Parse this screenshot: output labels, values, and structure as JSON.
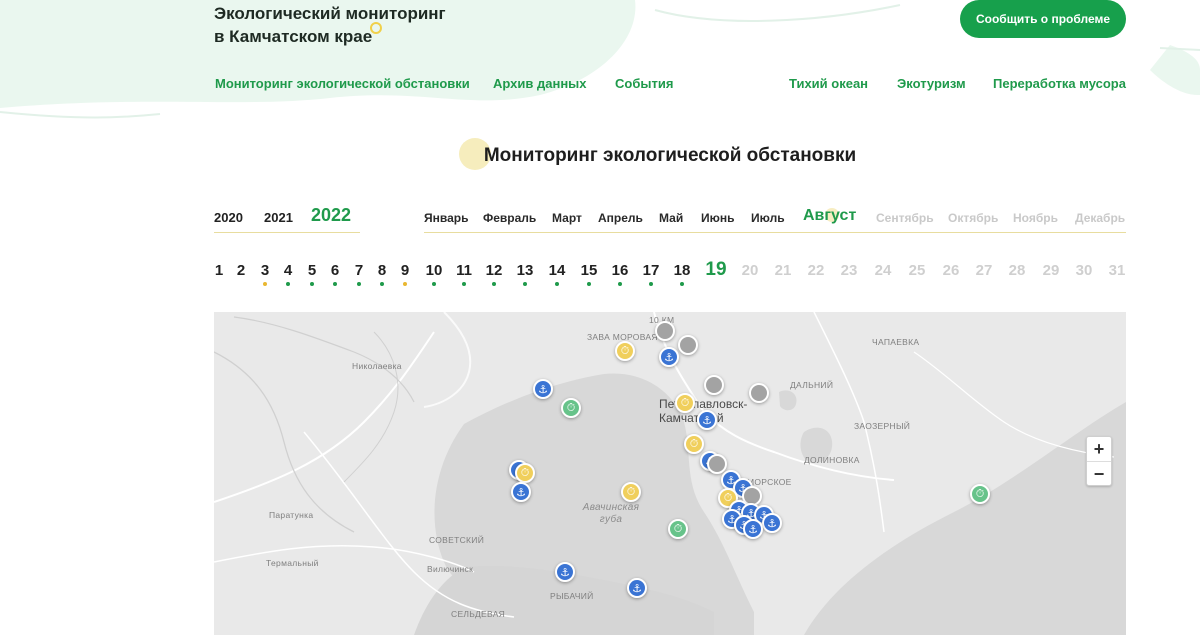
{
  "header": {
    "logo_line1": "Экологический мониторинг",
    "logo_line2": "в Камчатском крае",
    "cta_label": "Сообщить о проблеме"
  },
  "nav": {
    "left": [
      "Мониторинг экологической обстановки",
      "Архив данных",
      "События"
    ],
    "right": [
      "Тихий океан",
      "Экотуризм",
      "Переработка мусора"
    ]
  },
  "page_title": "Мониторинг экологической обстановки",
  "years": [
    "2020",
    "2021",
    "2022"
  ],
  "active_year": "2022",
  "months": [
    "Январь",
    "Февраль",
    "Март",
    "Апрель",
    "Май",
    "Июнь",
    "Июль",
    "Август",
    "Сентябрь",
    "Октябрь",
    "Ноябрь",
    "Декабрь"
  ],
  "active_month": "Август",
  "days": [
    "1",
    "2",
    "3",
    "4",
    "5",
    "6",
    "7",
    "8",
    "9",
    "10",
    "11",
    "12",
    "13",
    "14",
    "15",
    "16",
    "17",
    "18",
    "19",
    "20",
    "21",
    "22",
    "23",
    "24",
    "25",
    "26",
    "27",
    "28",
    "29",
    "30",
    "31"
  ],
  "active_day": "19",
  "map": {
    "labels": {
      "city": "Петропавловск-Камчатский",
      "bay": "Авачинская губа",
      "nikolaevka": "Николаевка",
      "paratunka": "Паратунка",
      "sovetsky": "СОВЕТСКИЙ",
      "termalny": "Термальный",
      "vilyuchinsk": "Вилючинск",
      "rybachy": "РЫБАЧИЙ",
      "selдyanka": "СЕЛЬДЕВАЯ",
      "chapaevka": "ЧАПАЕВКА",
      "dalny": "ДАЛЬНИЙ",
      "zaozerny": "ЗАОЗЕРНЫЙ",
      "dolinovka": "ДОЛИНОВКА",
      "km10": "10 КМ",
      "morskoe": "МОРСКОЕ",
      "zavoyko": "ЗАВА МОРОВАЯ"
    },
    "zoom_in": "+",
    "zoom_out": "−"
  },
  "colors": {
    "accent": "#1f9a4b",
    "marker_blue": "#3a74d4",
    "marker_yellow": "#f0cf5c",
    "marker_green": "#67c38a",
    "marker_gray": "#a3a3a3"
  }
}
